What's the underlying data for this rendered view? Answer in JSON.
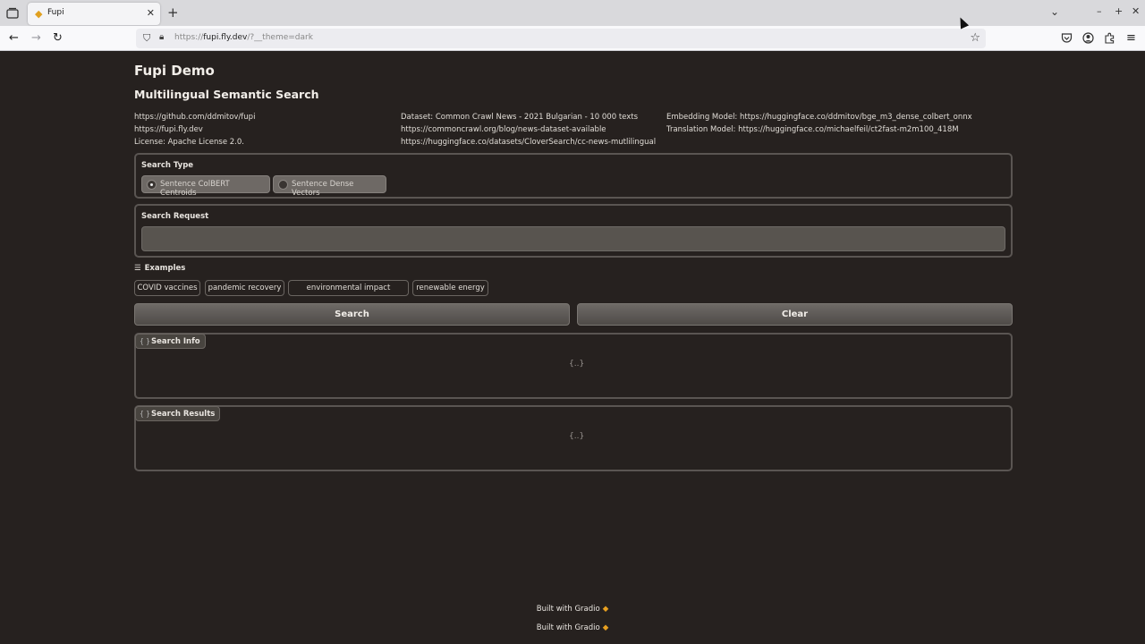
{
  "browser": {
    "tab_title": "Fupi",
    "new_tab_icon": "+",
    "url_prefix": "https://",
    "url_host": "fupi.fly.dev",
    "url_path": "/?__theme=dark"
  },
  "app": {
    "title": "Fupi Demo",
    "subtitle": "Multilingual Semantic Search"
  },
  "meta": {
    "col1": [
      "https://github.com/ddmitov/fupi",
      "https://fupi.fly.dev",
      "License: Apache License 2.0."
    ],
    "col2": [
      "Dataset: Common Crawl News - 2021 Bulgarian - 10 000 texts",
      "https://commoncrawl.org/blog/news-dataset-available",
      "https://huggingface.co/datasets/CloverSearch/cc-news-mutlilingual"
    ],
    "col3": [
      "Embedding Model: https://huggingface.co/ddmitov/bge_m3_dense_colbert_onnx",
      "Translation Model: https://huggingface.co/michaelfeil/ct2fast-m2m100_418M"
    ]
  },
  "search_type": {
    "label": "Search Type",
    "options": [
      "Sentence ColBERT Centroids",
      "Sentence Dense Vectors"
    ],
    "selected": "Sentence ColBERT Centroids"
  },
  "search_request": {
    "label": "Search Request",
    "value": "",
    "placeholder": ""
  },
  "examples": {
    "label": "Examples",
    "items": [
      "COVID vaccines",
      "pandemic recovery",
      "environmental impact",
      "renewable energy"
    ]
  },
  "buttons": {
    "search": "Search",
    "clear": "Clear"
  },
  "outputs": {
    "search_info": {
      "label": "Search Info",
      "empty": "{..}"
    },
    "search_results": {
      "label": "Search Results",
      "empty": "{..}"
    }
  },
  "footer": {
    "line1": "Built with Gradio",
    "line2": "Built with Gradio"
  },
  "colors": {
    "background": "#26211f",
    "accent_logo": "#e8a020"
  }
}
